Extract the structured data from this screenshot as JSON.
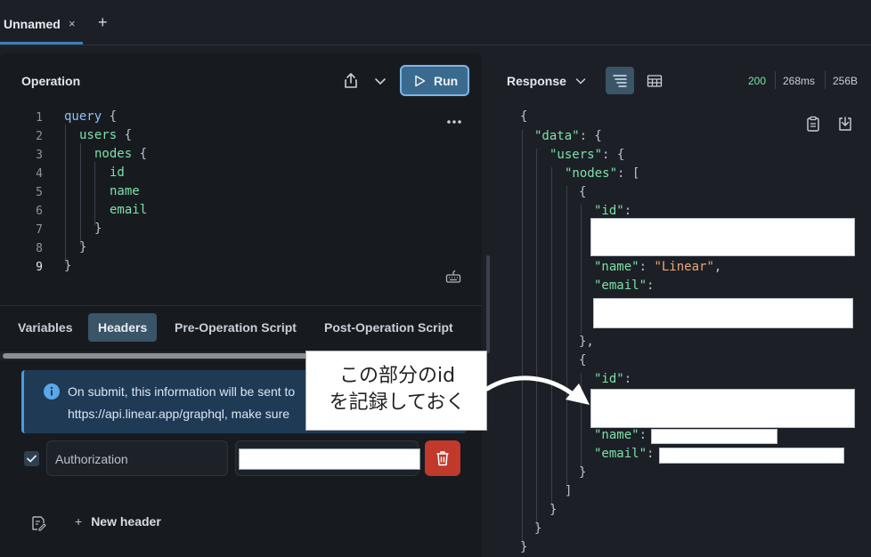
{
  "tabs": [
    {
      "label": "Unnamed",
      "close": "×"
    }
  ],
  "tab_add": "+",
  "operation": {
    "title": "Operation",
    "run_label": "Run",
    "line_numbers": [
      "1",
      "2",
      "3",
      "4",
      "5",
      "6",
      "7",
      "8",
      "9"
    ],
    "code": [
      {
        "kw": "query",
        "rest": " {"
      },
      {
        "field": "users",
        "rest": " {"
      },
      {
        "field": "nodes",
        "rest": " {"
      },
      {
        "field": "id",
        "rest": ""
      },
      {
        "field": "name",
        "rest": ""
      },
      {
        "field": "email",
        "rest": ""
      },
      {
        "field": "",
        "rest": "}"
      },
      {
        "field": "",
        "rest": "}"
      },
      {
        "field": "",
        "rest": "}"
      }
    ]
  },
  "subtabs": [
    "Variables",
    "Headers",
    "Pre-Operation Script",
    "Post-Operation Script"
  ],
  "active_subtab": "Headers",
  "info": {
    "line1": "On submit, this information will be sent to",
    "line2": "https://api.linear.app/graphql, make sure"
  },
  "header_row": {
    "key": "Authorization",
    "value": ""
  },
  "new_header_label": "New header",
  "response": {
    "title": "Response",
    "status_code": "200",
    "time": "268ms",
    "size": "256B",
    "json": {
      "open": "{",
      "data_key": "\"data\"",
      "users_key": "\"users\"",
      "nodes_key": "\"nodes\"",
      "id_key": "\"id\"",
      "name_key": "\"name\"",
      "email_key": "\"email\"",
      "name_val": "\"Linear\"",
      "close": "}"
    }
  },
  "callout": {
    "line1": "この部分のid",
    "line2": "を記録しておく"
  },
  "colors": {
    "accent": "#3f7fbd",
    "run": "#3a6a8e",
    "delete": "#c0392b",
    "info": "#1f3a55"
  }
}
